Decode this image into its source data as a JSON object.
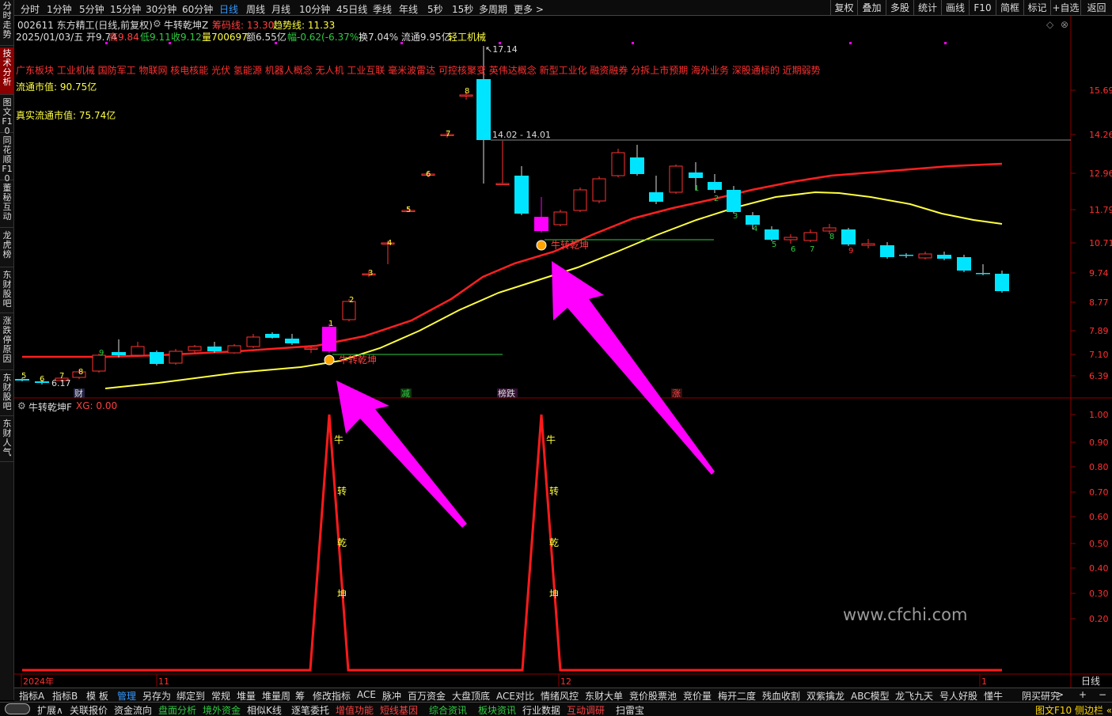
{
  "sidebar": {
    "tabs": [
      "分时走势",
      "技术分析",
      "图文F10",
      "同花顺F10",
      "董秘互动",
      "龙虎榜",
      "东财股吧",
      "涨跌停原因",
      "东财股吧",
      "东财人气"
    ],
    "active_index": 1
  },
  "topbar": {
    "periods": [
      "分时",
      "1分钟",
      "5分钟",
      "15分钟",
      "30分钟",
      "60分钟",
      "日线",
      "周线",
      "月线",
      "10分钟",
      "45日线",
      "季线",
      "年线",
      "5秒",
      "15秒",
      "多周期",
      "更多 >"
    ],
    "active_period": "日线",
    "right_buttons": [
      "复权",
      "叠加",
      "多股",
      "统计",
      "画线",
      "F10",
      "简框",
      "标记",
      "+自选",
      "返回"
    ]
  },
  "info": {
    "line1_code_name": "002611 东方精工(日线,前复权)",
    "indicator_name": "牛转乾坤Z",
    "chip_line": "筹码线: 13.30",
    "trend_line": "趋势线: 11.33",
    "line2_date_open": "2025/01/03/五  开9.74",
    "line2_high": "高9.84",
    "line2_low": "低9.11",
    "line2_close": "收9.12",
    "line2_vol": "量700697",
    "line2_amount": "额6.55亿",
    "line2_change": "幅-0.62(-6.37%)",
    "line2_turnover": "换7.04%  流通9.95亿",
    "line2_industry": "轻工机械",
    "concepts": "广东板块 工业机械 国防军工 物联网 核电核能 光伏 氢能源 机器人概念 无人机 工业互联 毫米波雷达 可控核聚变 英伟达概念 新型工业化 融资融券 分拆上市预期 海外业务 深股通标的 近期弱势",
    "float_cap": "流通市值: 90.75亿",
    "real_float_cap": "真实流通市值: 75.74亿"
  },
  "main_chart": {
    "y_ticks": [
      "15.69",
      "14.26",
      "12.96",
      "11.79",
      "10.71",
      "9.74",
      "8.77",
      "7.89",
      "7.10",
      "6.39"
    ],
    "high_label": "17.14",
    "low_label": "6.17",
    "range_label": "14.02 - 14.01",
    "signal_label": "牛转乾坤",
    "event_tags": [
      "财",
      "减",
      "榜跌",
      "涨"
    ],
    "colors": {
      "up": "#ff3232",
      "down": "#00e5ff",
      "signal": "#ff00ff",
      "ma_red": "#ff2020",
      "ma_yellow": "#ffff40"
    }
  },
  "sub_chart": {
    "title": "牛转乾坤F",
    "xg": "XG: 0.00",
    "y_ticks": [
      "1.00",
      "0.90",
      "0.80",
      "0.70",
      "0.60",
      "0.50",
      "0.40",
      "0.30",
      "0.20"
    ],
    "peak_chars": [
      "牛",
      "转",
      "乾",
      "坤"
    ]
  },
  "watermark": "www.cfchi.com",
  "date_axis": {
    "labels": [
      "2024年",
      "11",
      "12",
      "1"
    ],
    "right_label": "日线"
  },
  "bottom_tabs": [
    "指标A",
    "指标B",
    "模 板",
    "管理",
    "另存为",
    "绑定到",
    "常规",
    "堆量",
    "堆量周",
    "筹",
    "修改指标",
    "ACE",
    "脉冲",
    "百万资金",
    "大盘顶底",
    "ACE对比",
    "情绪风控",
    "东财大单",
    "竞价股票池",
    "竞价量",
    "梅开二度",
    "残血收割",
    "双紫擒龙",
    "ABC模型",
    "龙飞九天",
    "号人好股",
    "懂牛",
    "阴买研究",
    ">"
  ],
  "bottom_active": "管理",
  "status_tabs": [
    {
      "label": "扩展∧",
      "color": "#ddd"
    },
    {
      "label": "关联报价",
      "color": "#ddd"
    },
    {
      "label": "资金流向",
      "color": "#ddd"
    },
    {
      "label": "盘面分析",
      "color": "#2ecc40"
    },
    {
      "label": "境外资金",
      "color": "#2ecc40"
    },
    {
      "label": "相似K线",
      "color": "#ddd"
    },
    {
      "label": "逐笔委托",
      "color": "#ddd"
    },
    {
      "label": "增值功能",
      "color": "#ff4040"
    },
    {
      "label": "短线基因",
      "color": "#ff4040"
    },
    {
      "label": "综合资讯",
      "color": "#2ecc40"
    },
    {
      "label": "板块资讯",
      "color": "#2ecc40"
    },
    {
      "label": "行业数据",
      "color": "#ddd"
    },
    {
      "label": "互动调研",
      "color": "#ff4040"
    },
    {
      "label": "扫雷宝",
      "color": "#ddd"
    }
  ],
  "status_right": "图文F10  侧边栏 «"
}
